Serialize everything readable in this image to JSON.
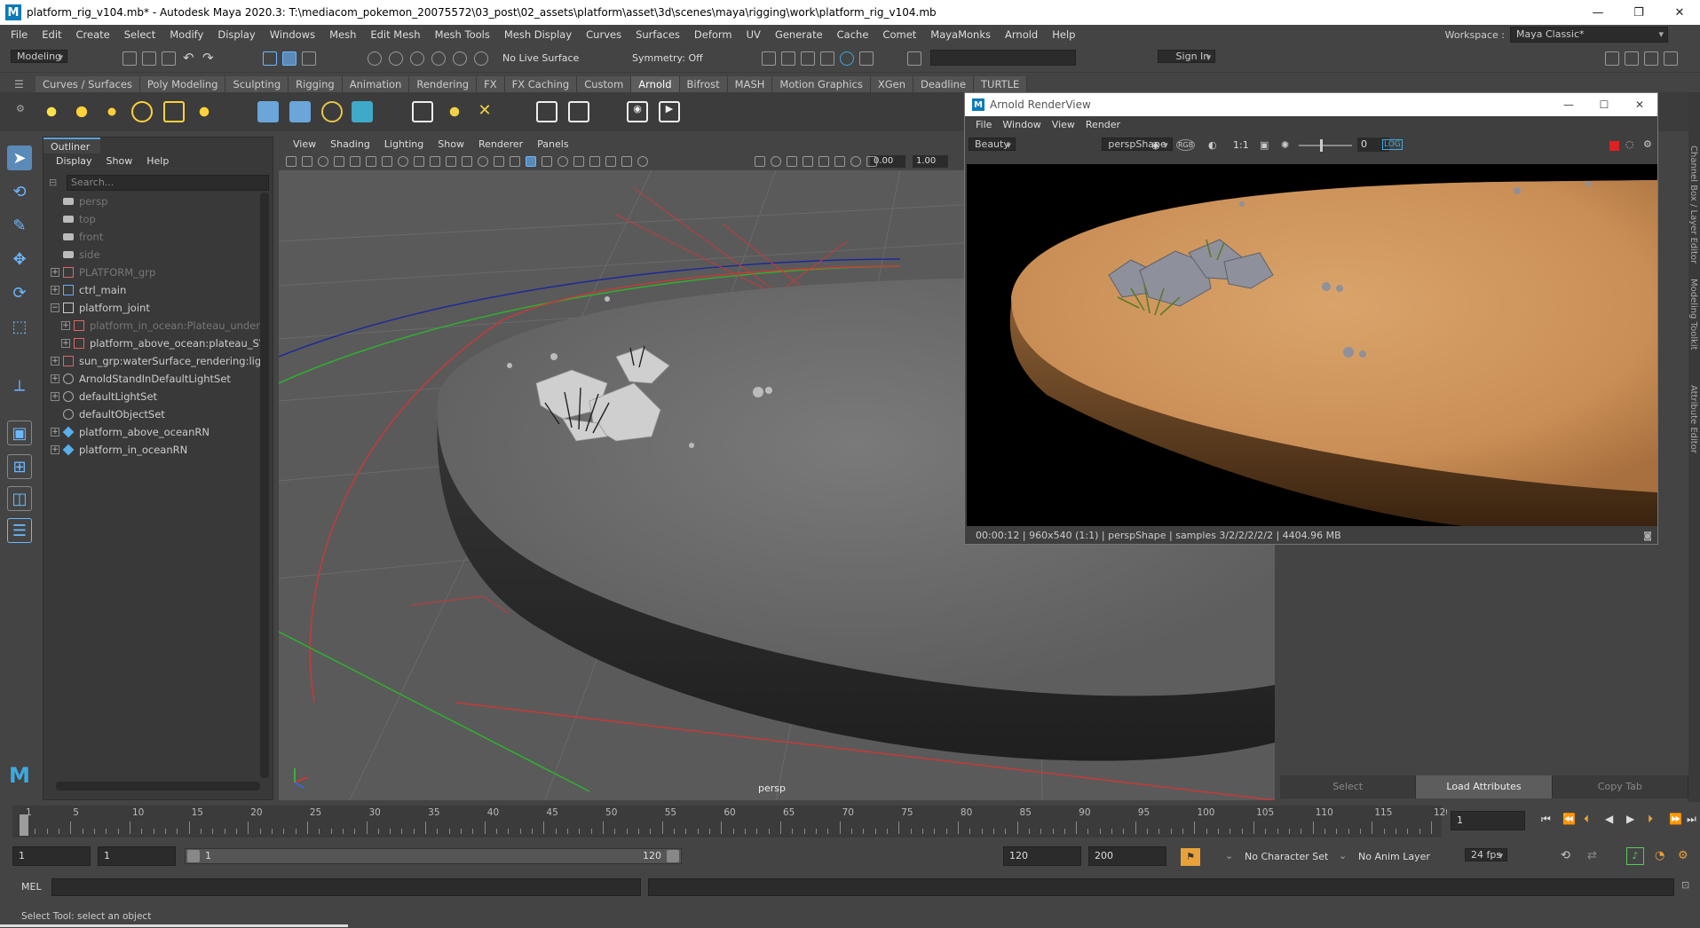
{
  "window": {
    "title": "platform_rig_v104.mb* - Autodesk Maya 2020.3: T:\\mediacom_pokemon_20075572\\03_post\\02_assets\\platform\\asset\\3d\\scenes\\maya\\rigging\\work\\platform_rig_v104.mb",
    "logo": "M"
  },
  "menubar": [
    "File",
    "Edit",
    "Create",
    "Select",
    "Modify",
    "Display",
    "Windows",
    "Mesh",
    "Edit Mesh",
    "Mesh Tools",
    "Mesh Display",
    "Curves",
    "Surfaces",
    "Deform",
    "UV",
    "Generate",
    "Cache",
    "Comet",
    "MayaMonks",
    "Arnold",
    "Help"
  ],
  "workspace": {
    "label": "Workspace :",
    "value": "Maya Classic*"
  },
  "statusline": {
    "menuset": "Modeling",
    "live_surface": "No Live Surface",
    "symmetry": "Symmetry: Off",
    "sign_in": "Sign In"
  },
  "shelf_tabs": [
    "Curves / Surfaces",
    "Poly Modeling",
    "Sculpting",
    "Rigging",
    "Animation",
    "Rendering",
    "FX",
    "FX Caching",
    "Custom",
    "Arnold",
    "Bifrost",
    "MASH",
    "Motion Graphics",
    "XGen",
    "Deadline",
    "TURTLE"
  ],
  "shelf_active": "Arnold",
  "outliner": {
    "tab": "Outliner",
    "menu": [
      "Display",
      "Show",
      "Help"
    ],
    "search_placeholder": "Search...",
    "items": [
      {
        "label": "persp",
        "indent": 1,
        "icon": "camera-icon",
        "dim": true,
        "expand": ""
      },
      {
        "label": "top",
        "indent": 1,
        "icon": "camera-icon",
        "dim": true,
        "expand": ""
      },
      {
        "label": "front",
        "indent": 1,
        "icon": "camera-icon",
        "dim": true,
        "expand": ""
      },
      {
        "label": "side",
        "indent": 1,
        "icon": "camera-icon",
        "dim": true,
        "expand": ""
      },
      {
        "label": "PLATFORM_grp",
        "indent": 1,
        "icon": "group-icon",
        "dim": true,
        "expand": "+"
      },
      {
        "label": "ctrl_main",
        "indent": 1,
        "icon": "curve-icon",
        "dim": false,
        "expand": "+"
      },
      {
        "label": "platform_joint",
        "indent": 1,
        "icon": "joint-icon",
        "dim": false,
        "expand": "−"
      },
      {
        "label": "platform_in_ocean:Plateau_under_",
        "indent": 2,
        "icon": "reference-icon",
        "dim": true,
        "expand": "+"
      },
      {
        "label": "platform_above_ocean:plateau_SW",
        "indent": 2,
        "icon": "reference-icon",
        "dim": false,
        "expand": "+"
      },
      {
        "label": "sun_grp:waterSurface_rendering:ligh",
        "indent": 1,
        "icon": "group-icon",
        "dim": false,
        "expand": "+"
      },
      {
        "label": "ArnoldStandInDefaultLightSet",
        "indent": 1,
        "icon": "set-icon",
        "dim": false,
        "expand": "+"
      },
      {
        "label": "defaultLightSet",
        "indent": 1,
        "icon": "set-icon",
        "dim": false,
        "expand": "+"
      },
      {
        "label": "defaultObjectSet",
        "indent": 1,
        "icon": "set-icon",
        "dim": false,
        "expand": ""
      },
      {
        "label": "platform_above_oceanRN",
        "indent": 1,
        "icon": "ref-node-icon",
        "dim": false,
        "expand": "+"
      },
      {
        "label": "platform_in_oceanRN",
        "indent": 1,
        "icon": "ref-node-icon",
        "dim": false,
        "expand": "+"
      }
    ]
  },
  "viewport": {
    "menu": [
      "View",
      "Shading",
      "Lighting",
      "Show",
      "Renderer",
      "Panels"
    ],
    "near": "0.00",
    "far": "1.00",
    "camera_label": "persp"
  },
  "renderview": {
    "title": "Arnold RenderView",
    "menu": [
      "File",
      "Window",
      "View",
      "Render"
    ],
    "aov": "Beauty",
    "camera": "perspShape",
    "ratio": "1:1",
    "exposure": "0",
    "status": "00:00:12 | 960x540 (1:1) | perspShape  | samples 3/2/2/2/2/2 | 4404.96 MB"
  },
  "attribute_editor": {
    "buttons": [
      "Select",
      "Load Attributes",
      "Copy Tab"
    ],
    "side_tabs": [
      "Channel Box / Layer Editor",
      "Modeling Toolkit",
      "Attribute Editor"
    ]
  },
  "timeslider": {
    "start": 1,
    "end": 120,
    "current": 1,
    "labels": [
      "1",
      "5",
      "10",
      "15",
      "20",
      "25",
      "30",
      "35",
      "40",
      "45",
      "50",
      "55",
      "60",
      "65",
      "70",
      "75",
      "80",
      "85",
      "90",
      "95",
      "100",
      "105",
      "110",
      "115",
      "120"
    ],
    "current_field": "1"
  },
  "range": {
    "start_field": "1",
    "range_start_field": "1",
    "slider_start": "1",
    "slider_end": "120",
    "end_field": "120",
    "anim_end_field": "200",
    "character_set": "No Character Set",
    "anim_layer": "No Anim Layer",
    "fps": "24 fps"
  },
  "cmdline": {
    "label": "MEL"
  },
  "helpline": {
    "text": "Select Tool: select an object"
  }
}
